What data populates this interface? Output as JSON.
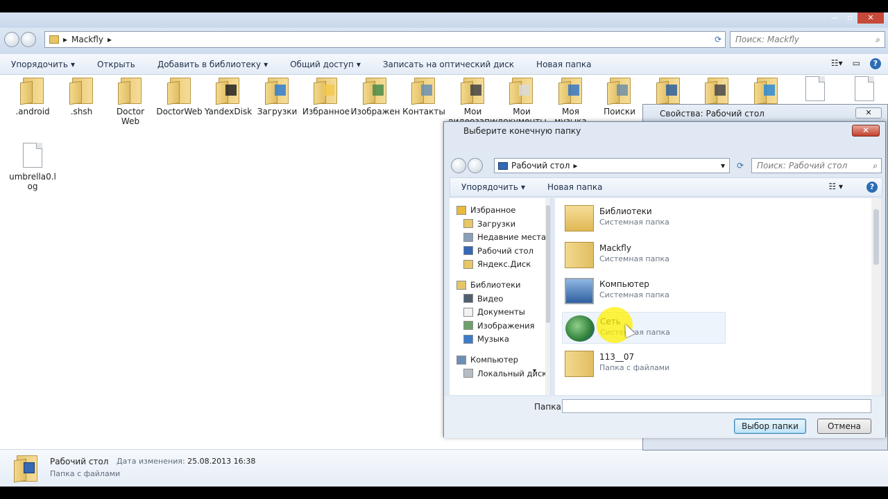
{
  "explorer": {
    "breadcrumb": [
      "Mackfly"
    ],
    "search_placeholder": "Поиск: Mackfly",
    "toolbar": [
      "Упорядочить",
      "Открыть",
      "Добавить в библиотеку",
      "Общий доступ",
      "Записать на оптический диск",
      "Новая папка"
    ],
    "items": [
      {
        "label": ".android",
        "type": "folder"
      },
      {
        "label": ".shsh",
        "type": "folder"
      },
      {
        "label": "Doctor Web",
        "type": "folder"
      },
      {
        "label": "DoctorWeb",
        "type": "folder"
      },
      {
        "label": "YandexDisk",
        "type": "folder"
      },
      {
        "label": "Загрузки",
        "type": "folder"
      },
      {
        "label": "Избранное",
        "type": "folder"
      },
      {
        "label": "Изображения",
        "type": "folder"
      },
      {
        "label": "Контакты",
        "type": "folder"
      },
      {
        "label": "Мои видеозаписи",
        "type": "folder"
      },
      {
        "label": "Мои документы",
        "type": "folder"
      },
      {
        "label": "Моя музыка",
        "type": "folder"
      },
      {
        "label": "Поиски",
        "type": "folder"
      },
      {
        "label": "",
        "type": "folder"
      },
      {
        "label": "",
        "type": "folder"
      },
      {
        "label": "",
        "type": "folder"
      },
      {
        "label": "",
        "type": "doc"
      },
      {
        "label": "",
        "type": "doc"
      }
    ],
    "file_item": {
      "label": "umbrella0.log"
    },
    "status": {
      "name": "Рабочий стол",
      "modified_label": "Дата изменения:",
      "modified_value": "25.08.2013 16:38",
      "type": "Папка с файлами"
    }
  },
  "properties_dialog": {
    "title": "Свойства: Рабочий стол"
  },
  "picker": {
    "title": "Выберите конечную папку",
    "address": "Рабочий стол",
    "search_placeholder": "Поиск: Рабочий стол",
    "toolbar": {
      "organize": "Упорядочить",
      "new_folder": "Новая папка"
    },
    "nav": [
      {
        "label": "Избранное",
        "level": 0,
        "icon": "star-icon"
      },
      {
        "label": "Загрузки",
        "level": 1,
        "icon": "downloads-icon"
      },
      {
        "label": "Недавние места",
        "level": 1,
        "icon": "recent-places-icon"
      },
      {
        "label": "Рабочий стол",
        "level": 1,
        "icon": "desktop-icon"
      },
      {
        "label": "Яндекс.Диск",
        "level": 1,
        "icon": "yandex-disk-icon"
      },
      {
        "label": "Библиотеки",
        "level": 0,
        "icon": "libraries-icon"
      },
      {
        "label": "Видео",
        "level": 1,
        "icon": "video-icon"
      },
      {
        "label": "Документы",
        "level": 1,
        "icon": "documents-icon"
      },
      {
        "label": "Изображения",
        "level": 1,
        "icon": "pictures-icon"
      },
      {
        "label": "Музыка",
        "level": 1,
        "icon": "music-icon"
      },
      {
        "label": "Компьютер",
        "level": 0,
        "icon": "computer-icon"
      },
      {
        "label": "Локальный диск",
        "level": 1,
        "icon": "local-disk-icon"
      }
    ],
    "items": [
      {
        "name": "Библиотеки",
        "type": "Системная папка",
        "icon": "libraries-folder-icon"
      },
      {
        "name": "Mackfly",
        "type": "Системная папка",
        "icon": "user-folder-icon"
      },
      {
        "name": "Компьютер",
        "type": "Системная папка",
        "icon": "computer-icon"
      },
      {
        "name": "Сеть",
        "type": "Системная папка",
        "icon": "network-icon"
      },
      {
        "name": "113__07",
        "type": "Папка с файлами",
        "icon": "folder-icon"
      }
    ],
    "folder_label": "Папка:",
    "folder_value": "",
    "select_button": "Выбор папки",
    "cancel_button": "Отмена"
  }
}
